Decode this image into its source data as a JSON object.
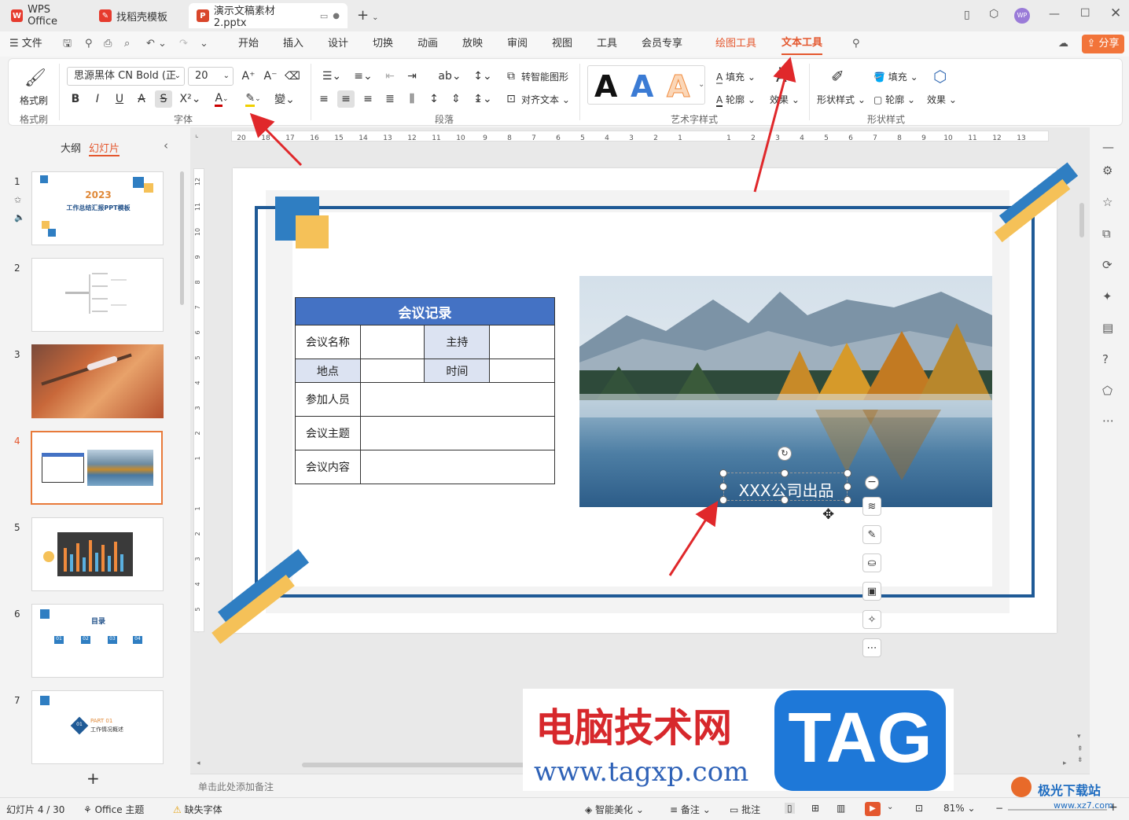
{
  "tabs": [
    {
      "label": "WPS Office"
    },
    {
      "label": "找稻壳模板"
    },
    {
      "label": "演示文稿素材2.pptx"
    }
  ],
  "titlebar": {
    "add_tab": "+",
    "avatar_initials": "WP"
  },
  "menu": {
    "file": "文件",
    "items": [
      "开始",
      "插入",
      "设计",
      "切换",
      "动画",
      "放映",
      "审阅",
      "视图",
      "工具",
      "会员专享"
    ],
    "drawing_tools": "绘图工具",
    "text_tools": "文本工具",
    "share": "分享"
  },
  "ribbon": {
    "format_painter": "格式刷",
    "format_painter_group": "格式刷",
    "font_name": "思源黑体 CN Bold (正",
    "font_size": "20",
    "font_group": "字体",
    "paragraph_group": "段落",
    "to_smart_shape": "转智能图形",
    "align_text": "对齐文本",
    "art_group": "艺术字样式",
    "fill": "填充",
    "outline": "轮廓",
    "effect": "效果",
    "shape_style": "形状样式",
    "shape_fill": "填充",
    "shape_outline": "轮廓",
    "shape_effect": "效果",
    "shape_group": "形状样式",
    "art_sample": "A"
  },
  "left_panel": {
    "outline_tab": "大纲",
    "slides_tab": "幻灯片",
    "add": "+",
    "slides": [
      {
        "num": "1",
        "title": "2023",
        "subtitle": "工作总结汇报PPT模板"
      },
      {
        "num": "2"
      },
      {
        "num": "3"
      },
      {
        "num": "4"
      },
      {
        "num": "5"
      },
      {
        "num": "6",
        "title": "目录",
        "labels": [
          "01",
          "02",
          "03",
          "04"
        ]
      },
      {
        "num": "7",
        "title": "PART 01",
        "subtitle": "工作情况概述",
        "badge": "01"
      }
    ]
  },
  "ruler": {
    "h_ticks": [
      "20",
      "18",
      "17",
      "16",
      "15",
      "14",
      "13",
      "12",
      "11",
      "10",
      "9",
      "8",
      "7",
      "6",
      "5",
      "4",
      "3",
      "2",
      "1",
      "",
      "1",
      "2",
      "3",
      "4",
      "5",
      "6",
      "7",
      "8",
      "9",
      "10",
      "11",
      "12",
      "13"
    ],
    "v_ticks": [
      "12",
      "11",
      "10",
      "9",
      "8",
      "7",
      "6",
      "5",
      "4",
      "3",
      "2",
      "1",
      "",
      "1",
      "2",
      "3",
      "4",
      "5",
      "6"
    ]
  },
  "slide": {
    "table_title": "会议记录",
    "rows": [
      [
        "会议名称",
        "",
        "主持",
        ""
      ],
      [
        "地点",
        "",
        "时间",
        ""
      ],
      [
        "参加人员",
        ""
      ],
      [
        "会议主题",
        ""
      ],
      [
        "会议内容",
        ""
      ]
    ],
    "caption": "XXX公司出品"
  },
  "notes": {
    "placeholder": "单击此处添加备注"
  },
  "status": {
    "slide_count": "幻灯片 4 / 30",
    "theme": "Office 主题",
    "missing_font": "缺失字体",
    "beautify": "智能美化",
    "notes": "备注",
    "comments": "批注",
    "zoom": "81%"
  },
  "watermark": {
    "site_title": "电脑技术网",
    "url": "www.tagxp.com",
    "tag": "TAG",
    "brand": "极光下载站",
    "brand_url": "www.xz7.com"
  },
  "colors": {
    "accent_orange": "#e4572e",
    "slide_blue": "#1f5a96",
    "table_header": "#4472c4",
    "table_cell": "#dce3f2",
    "deco_yellow": "#f5c158",
    "deco_blue": "#2f7ec2",
    "annotation_red": "#e0282b"
  }
}
